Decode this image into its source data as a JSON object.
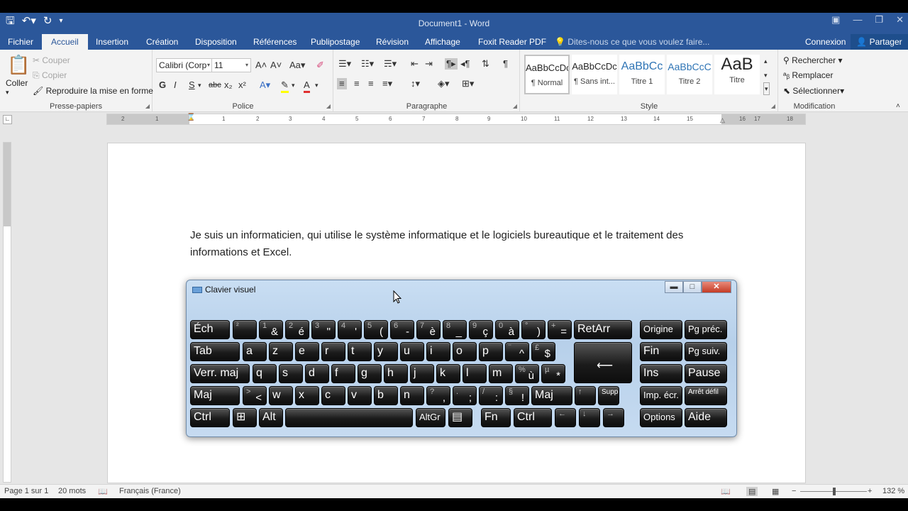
{
  "window": {
    "title": "Document1 - Word"
  },
  "tabs": {
    "file": "Fichier",
    "home": "Accueil",
    "insert": "Insertion",
    "design": "Création",
    "layout": "Disposition",
    "references": "Références",
    "mailings": "Publipostage",
    "review": "Révision",
    "view": "Affichage",
    "foxit": "Foxit Reader PDF",
    "tellme": "Dites-nous ce que vous voulez faire...",
    "account": "Connexion",
    "share": "Partager"
  },
  "clipboard": {
    "paste": "Coller",
    "cut": "Couper",
    "copy": "Copier",
    "format_painter": "Reproduire la mise en forme",
    "label": "Presse-papiers"
  },
  "font": {
    "name": "Calibri (Corp",
    "size": "11",
    "label": "Police",
    "case": "Aa",
    "bold": "G",
    "italic": "I",
    "underline": "S",
    "strike": "abc",
    "sub": "x₂",
    "sup": "x²"
  },
  "paragraph": {
    "label": "Paragraphe"
  },
  "styles": {
    "label": "Style",
    "items": [
      {
        "preview": "AaBbCcDc",
        "name": "¶ Normal"
      },
      {
        "preview": "AaBbCcDc",
        "name": "¶ Sans int..."
      },
      {
        "preview": "AaBbCc",
        "name": "Titre 1"
      },
      {
        "preview": "AaBbCcC",
        "name": "Titre 2"
      },
      {
        "preview": "AaB",
        "name": "Titre"
      }
    ]
  },
  "editing": {
    "find": "Rechercher",
    "replace": "Remplacer",
    "select": "Sélectionner",
    "label": "Modification"
  },
  "ruler": {
    "ticks": [
      "2",
      "1",
      "1",
      "2",
      "3",
      "4",
      "5",
      "6",
      "7",
      "8",
      "9",
      "10",
      "11",
      "12",
      "13",
      "14",
      "15",
      "16",
      "17",
      "18"
    ]
  },
  "document": {
    "text": "Je suis un informaticien, qui utilise le système informatique et le logiciels bureautique et le traitement des informations et Excel."
  },
  "osk": {
    "title": "Clavier visuel",
    "row1": [
      {
        "m": "Éch"
      },
      {
        "s": "²"
      },
      {
        "s": "1",
        "b": "&"
      },
      {
        "s": "2",
        "b": "é"
      },
      {
        "s": "3",
        "b": "\""
      },
      {
        "s": "4",
        "b": "'"
      },
      {
        "s": "5",
        "b": "("
      },
      {
        "s": "6",
        "b": "-"
      },
      {
        "s": "7",
        "b": "è"
      },
      {
        "s": "8",
        "b": "_"
      },
      {
        "s": "9",
        "b": "ç"
      },
      {
        "s": "0",
        "b": "à"
      },
      {
        "s": "°",
        "b": ")"
      },
      {
        "s": "+",
        "b": "="
      },
      {
        "m": "RetArr"
      },
      {
        "sm": "Origine"
      },
      {
        "sm": "Pg préc."
      }
    ],
    "row2": [
      {
        "m": "Tab"
      },
      {
        "m": "a"
      },
      {
        "m": "z"
      },
      {
        "m": "e"
      },
      {
        "m": "r"
      },
      {
        "m": "t"
      },
      {
        "m": "y"
      },
      {
        "m": "u"
      },
      {
        "m": "i"
      },
      {
        "m": "o"
      },
      {
        "m": "p"
      },
      {
        "s": "¨",
        "b": "^"
      },
      {
        "s": "£",
        "b": "$"
      },
      {
        "m": ""
      },
      {
        "m": "Fin"
      },
      {
        "sm": "Pg suiv."
      }
    ],
    "row3": [
      {
        "m": "Verr. maj"
      },
      {
        "m": "q"
      },
      {
        "m": "s"
      },
      {
        "m": "d"
      },
      {
        "m": "f"
      },
      {
        "m": "g"
      },
      {
        "m": "h"
      },
      {
        "m": "j"
      },
      {
        "m": "k"
      },
      {
        "m": "l"
      },
      {
        "m": "m"
      },
      {
        "s": "%",
        "b": "ù"
      },
      {
        "s": "µ",
        "b": "*"
      },
      {
        "m": "Ins"
      },
      {
        "m": "Pause"
      }
    ],
    "row4": [
      {
        "m": "Maj"
      },
      {
        "s": ">",
        "b": "<"
      },
      {
        "m": "w"
      },
      {
        "m": "x"
      },
      {
        "m": "c"
      },
      {
        "m": "v"
      },
      {
        "m": "b"
      },
      {
        "m": "n"
      },
      {
        "s": "?",
        "b": ","
      },
      {
        "s": ".",
        "b": ";"
      },
      {
        "s": "/",
        "b": ":"
      },
      {
        "s": "§",
        "b": "!"
      },
      {
        "m": "Maj"
      },
      {
        "s": "↑"
      },
      {
        "xs": "Suppr"
      },
      {
        "sm": "Imp. écr."
      },
      {
        "xs": "Arrêt défil"
      }
    ],
    "row5": [
      {
        "m": "Ctrl"
      },
      {
        "m": "⊞"
      },
      {
        "m": "Alt"
      },
      {
        "m": ""
      },
      {
        "sm": "AltGr"
      },
      {
        "m": "▤"
      },
      {
        "m": "Fn"
      },
      {
        "m": "Ctrl"
      },
      {
        "s": "←"
      },
      {
        "s": "↓"
      },
      {
        "s": "→"
      },
      {
        "sm": "Options"
      },
      {
        "m": "Aide"
      }
    ]
  },
  "status": {
    "page": "Page 1 sur 1",
    "words": "20 mots",
    "language": "Français (France)",
    "zoom": "132 %"
  }
}
